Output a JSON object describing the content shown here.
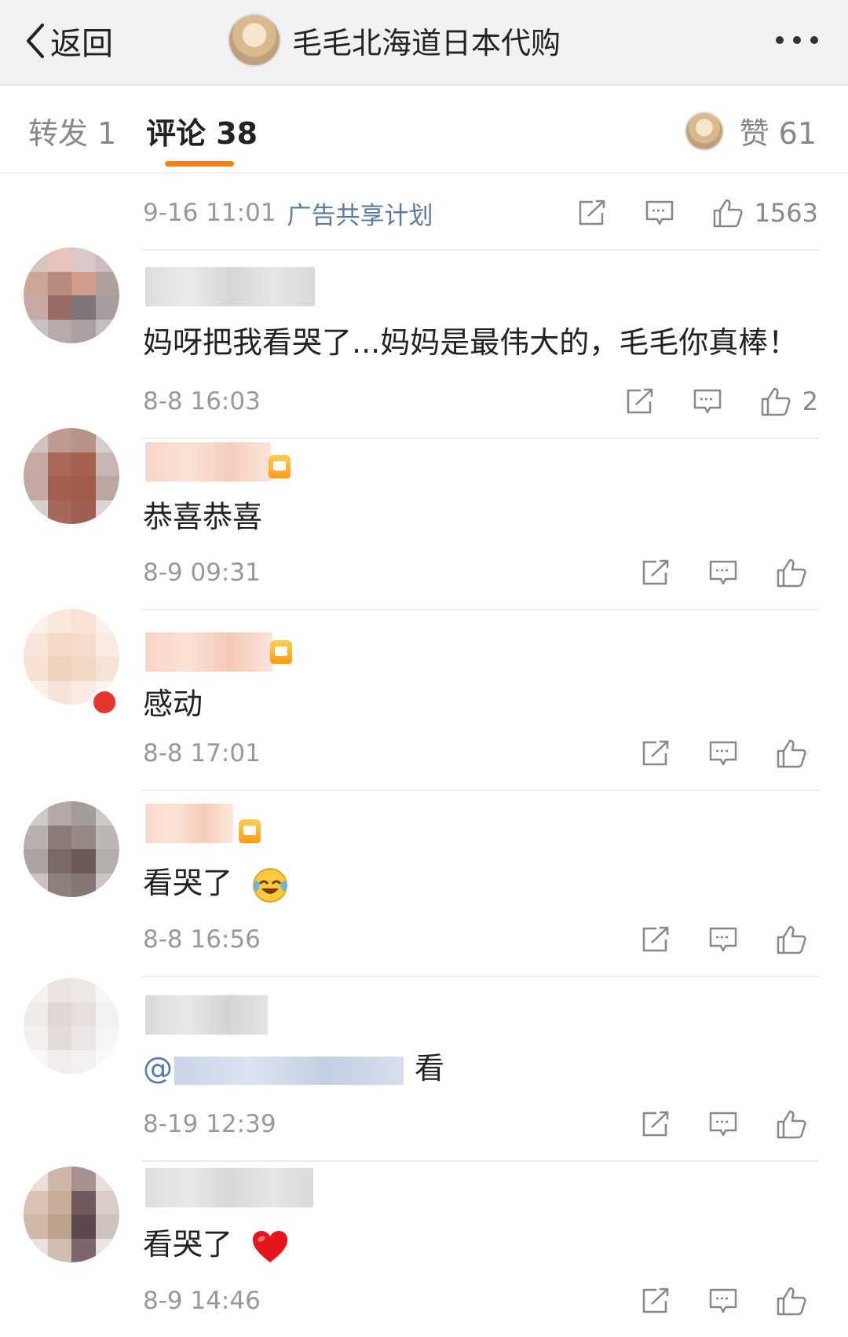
{
  "header": {
    "back_label": "返回",
    "title": "毛毛北海道日本代购"
  },
  "tabs": {
    "repost": "转发 1",
    "comments": "评论 38",
    "likes": "赞 61"
  },
  "post": {
    "time": "9-16 11:01",
    "ad_link": "广告共享计划",
    "like_count": "1563"
  },
  "comments": [
    {
      "text": "妈呀把我看哭了...妈妈是最伟大的，毛毛你真棒！",
      "time": "8-8 16:03",
      "likes": "2"
    },
    {
      "text": "恭喜恭喜",
      "time": "8-9 09:31",
      "likes": ""
    },
    {
      "text": "感动",
      "time": "8-8 17:01",
      "likes": ""
    },
    {
      "text": "看哭了",
      "emoji": "laugh-cry-emoji",
      "time": "8-8 16:56",
      "likes": ""
    },
    {
      "text_prefix": "@",
      "text_suffix": "看",
      "time": "8-19 12:39",
      "likes": ""
    },
    {
      "text": "看哭了",
      "emoji": "heart-emoji",
      "time": "8-9 14:46",
      "likes": ""
    }
  ],
  "icons": {
    "share": "share-icon",
    "comment": "comment-icon",
    "like": "thumbs-up-icon"
  },
  "colors": {
    "accent": "#ff8200",
    "link": "#5b7ba7",
    "muted": "#999999",
    "header_bg": "#f2f2f4"
  }
}
